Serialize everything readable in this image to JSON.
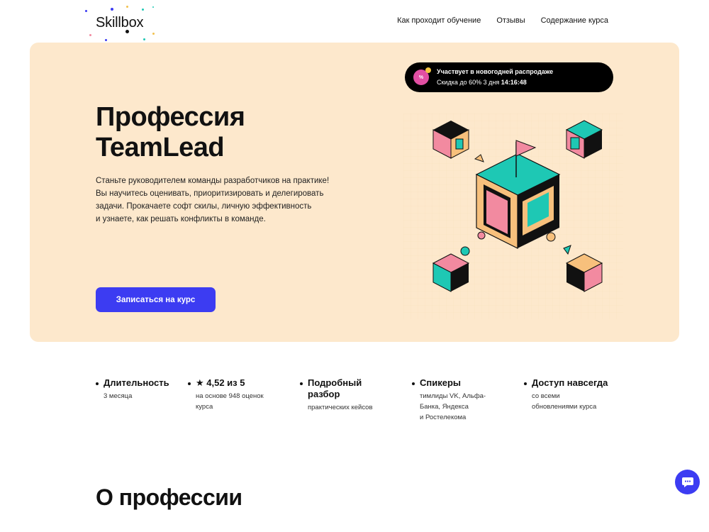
{
  "header": {
    "logo_text": "Skillbox",
    "nav": [
      {
        "label": "Как проходит обучение"
      },
      {
        "label": "Отзывы"
      },
      {
        "label": "Содержание курса"
      }
    ]
  },
  "hero": {
    "title_line1": "Профессия",
    "title_line2": "TeamLead",
    "description_lines": [
      "Станьте руководителем команды разработчиков на практике!",
      "Вы научитесь оценивать, приоритизировать и делегировать",
      "задачи. Прокачаете софт скилы, личную эффективность",
      "и узнаете, как решать конфликты в команде."
    ],
    "cta_label": "Записаться на курс",
    "promo": {
      "icon_text": "%",
      "line1": "Участвует в новогодней распродаже",
      "line2_prefix": "Скидка до 60% 3 дня ",
      "timer": "14:16:48"
    }
  },
  "features": [
    {
      "title": [
        "Длительность"
      ],
      "sub": [
        "3 месяца"
      ]
    },
    {
      "title": [
        "★ 4,52 из 5"
      ],
      "sub": [
        "на основе 948 оценок",
        "курса"
      ]
    },
    {
      "title": [
        "Подробный",
        "разбор"
      ],
      "sub": [
        "практических кейсов"
      ]
    },
    {
      "title": [
        "Спикеры"
      ],
      "sub": [
        "тимлиды VK, Альфа-",
        "Банка, Яндекса",
        "и Ростелекома"
      ]
    },
    {
      "title": [
        "Доступ навсегда"
      ],
      "sub": [
        "со всеми",
        "обновлениями курса"
      ]
    }
  ],
  "section": {
    "title": "О профессии"
  },
  "colors": {
    "accent": "#3c3cf2",
    "hero_bg": "#fde8cc",
    "teal": "#1ec8b4",
    "pink": "#f28aa0",
    "orange": "#f7c07c"
  },
  "icons": {
    "promo": "discount-badge-icon",
    "chat": "chat-bubble-icon"
  }
}
